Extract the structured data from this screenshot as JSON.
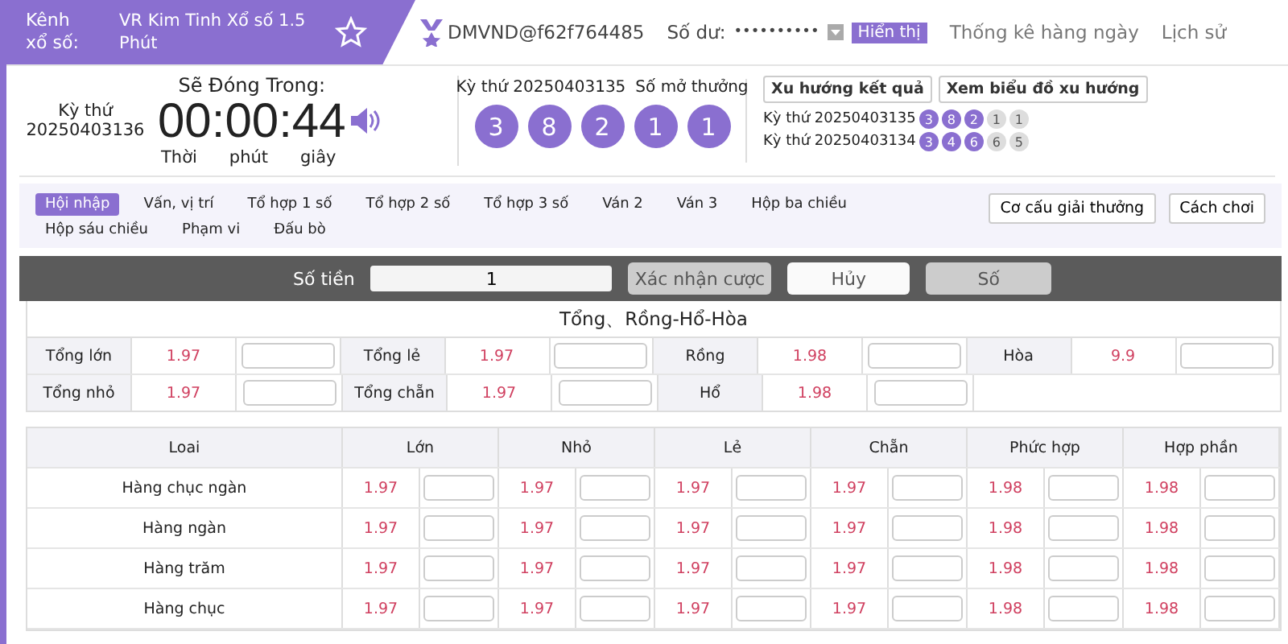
{
  "header": {
    "channel_label": "Kênh xổ số:",
    "channel_name": "VR Kim Tinh Xổ số 1.5 Phút",
    "user": "DMVND@f62f764485",
    "balance_label": "Số dư:",
    "balance": "••••••••••",
    "show_button": "Hiển thị",
    "nav": [
      "Thống kê hàng ngày",
      "Lịch sử"
    ]
  },
  "countdown": {
    "period_label": "Kỳ thứ",
    "period": "20250403136",
    "title": "Sẽ Đóng Trong:",
    "time": "00:00:44",
    "units": [
      "Thời",
      "phút",
      "giây"
    ]
  },
  "result": {
    "period": "Kỳ thứ 20250403135",
    "draw_label": "Số mở thưởng",
    "balls": [
      "3",
      "8",
      "2",
      "1",
      "1"
    ]
  },
  "trend": {
    "buttons": [
      "Xu hướng kết quả",
      "Xem biểu đồ xu hướng"
    ],
    "rows": [
      {
        "label": "Kỳ thứ 20250403135",
        "balls": [
          {
            "n": "3",
            "highlighted": true
          },
          {
            "n": "8",
            "highlighted": true
          },
          {
            "n": "2",
            "highlighted": true
          },
          {
            "n": "1",
            "highlighted": false
          },
          {
            "n": "1",
            "highlighted": false
          }
        ]
      },
      {
        "label": "Kỳ thứ 20250403134",
        "balls": [
          {
            "n": "3",
            "highlighted": true
          },
          {
            "n": "4",
            "highlighted": true
          },
          {
            "n": "6",
            "highlighted": true
          },
          {
            "n": "6",
            "highlighted": false
          },
          {
            "n": "5",
            "highlighted": false
          }
        ]
      }
    ]
  },
  "tabs": [
    {
      "label": "Hội nhập",
      "selected": true
    },
    {
      "label": "Vấn, vị trí",
      "selected": false
    },
    {
      "label": "Tổ hợp 1 số",
      "selected": false
    },
    {
      "label": "Tổ hợp 2 số",
      "selected": false
    },
    {
      "label": "Tổ hợp 3 số",
      "selected": false
    },
    {
      "label": "Ván 2",
      "selected": false
    },
    {
      "label": "Ván 3",
      "selected": false
    },
    {
      "label": "Hộp ba chiều",
      "selected": false
    },
    {
      "label": "Hộp sáu chiều",
      "selected": false
    },
    {
      "label": "Phạm vi",
      "selected": false
    },
    {
      "label": "Đấu bò",
      "selected": false
    }
  ],
  "side_buttons": [
    "Cơ cấu giải thưởng",
    "Cách chơi"
  ],
  "bet_bar": {
    "amount_label": "Số tiền",
    "amount": "1",
    "buttons": [
      {
        "label": "Xác nhận cược",
        "disabled": true
      },
      {
        "label": "Hủy",
        "disabled": false
      },
      {
        "label": "Số",
        "disabled": true
      }
    ]
  },
  "section": {
    "title": "Tổng、Rồng-Hổ-Hòa",
    "rows": [
      [
        {
          "label": "Tổng lớn",
          "odds": "1.97"
        },
        {
          "label": "Tổng lẻ",
          "odds": "1.97"
        },
        {
          "label": "Rồng",
          "odds": "1.98"
        },
        {
          "label": "Hòa",
          "odds": "9.9"
        }
      ],
      [
        {
          "label": "Tổng nhỏ",
          "odds": "1.97"
        },
        {
          "label": "Tổng chẵn",
          "odds": "1.97"
        },
        {
          "label": "Hổ",
          "odds": "1.98"
        }
      ]
    ]
  },
  "table": {
    "columns": [
      "Loai",
      "Lớn",
      "Nhỏ",
      "Lẻ",
      "Chẵn",
      "Phức hợp",
      "Hợp phần"
    ],
    "rows": [
      {
        "label": "Hàng chục ngàn",
        "odds": [
          "1.97",
          "1.97",
          "1.97",
          "1.97",
          "1.98",
          "1.98"
        ]
      },
      {
        "label": "Hàng ngàn",
        "odds": [
          "1.97",
          "1.97",
          "1.97",
          "1.97",
          "1.98",
          "1.98"
        ]
      },
      {
        "label": "Hàng trăm",
        "odds": [
          "1.97",
          "1.97",
          "1.97",
          "1.97",
          "1.98",
          "1.98"
        ]
      },
      {
        "label": "Hàng chục",
        "odds": [
          "1.97",
          "1.97",
          "1.97",
          "1.97",
          "1.98",
          "1.98"
        ]
      }
    ]
  }
}
